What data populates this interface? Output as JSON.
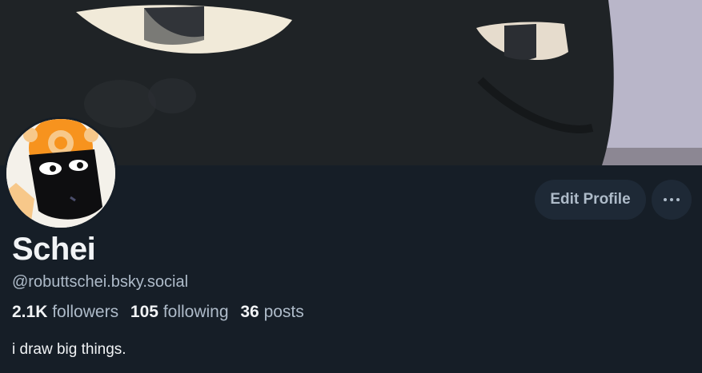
{
  "profile": {
    "display_name": "Schei",
    "handle": "@robuttschei.bsky.social",
    "bio": "i draw big things."
  },
  "stats": {
    "followers_count": "2.1K",
    "followers_label": "followers",
    "following_count": "105",
    "following_label": "following",
    "posts_count": "36",
    "posts_label": "posts"
  },
  "actions": {
    "edit_label": "Edit Profile",
    "more_icon": "ellipsis-icon"
  },
  "colors": {
    "background": "#161e27",
    "button_bg": "#1e2936",
    "muted_text": "#aebbc9",
    "primary_text": "#f1f3f5",
    "avatar_accent": "#f7931e"
  }
}
